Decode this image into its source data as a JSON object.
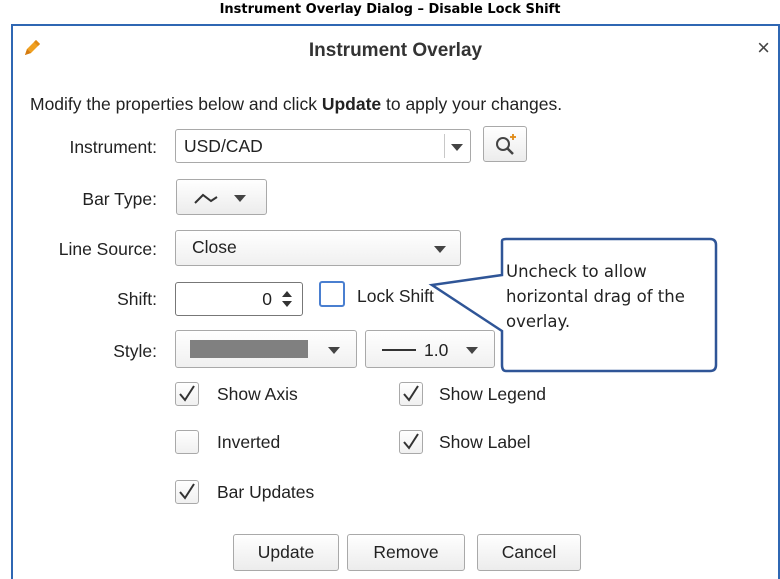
{
  "caption": "Instrument Overlay Dialog – Disable Lock Shift",
  "dialog": {
    "title": "Instrument Overlay",
    "title_icon": "pencil-icon",
    "close_label": "×",
    "intro_before": "Modify the properties below and click ",
    "intro_bold": "Update",
    "intro_after": " to apply your changes."
  },
  "fields": {
    "instrument": {
      "label": "Instrument:",
      "value": "USD/CAD",
      "search_icon": "search-add-icon"
    },
    "bar_type": {
      "label": "Bar Type:",
      "icon": "line-chart-icon"
    },
    "line_source": {
      "label": "Line Source:",
      "value": "Close"
    },
    "shift": {
      "label": "Shift:",
      "value": "0",
      "lock_label": "Lock Shift",
      "lock_checked": false
    },
    "style": {
      "label": "Style:",
      "color": "#808080",
      "line_width": "1.0"
    }
  },
  "checkboxes": {
    "show_axis": {
      "label": "Show Axis",
      "checked": true
    },
    "show_legend": {
      "label": "Show Legend",
      "checked": true
    },
    "inverted": {
      "label": "Inverted",
      "checked": false
    },
    "show_label": {
      "label": "Show Label",
      "checked": true
    },
    "bar_updates": {
      "label": "Bar Updates",
      "checked": true
    }
  },
  "buttons": {
    "update": "Update",
    "remove": "Remove",
    "cancel": "Cancel"
  },
  "callout": {
    "text": "Uncheck to allow horizontal drag of the overlay."
  },
  "colors": {
    "accent": "#2f67b3",
    "callout_border": "#2f5597",
    "pencil": "#f0a020"
  }
}
